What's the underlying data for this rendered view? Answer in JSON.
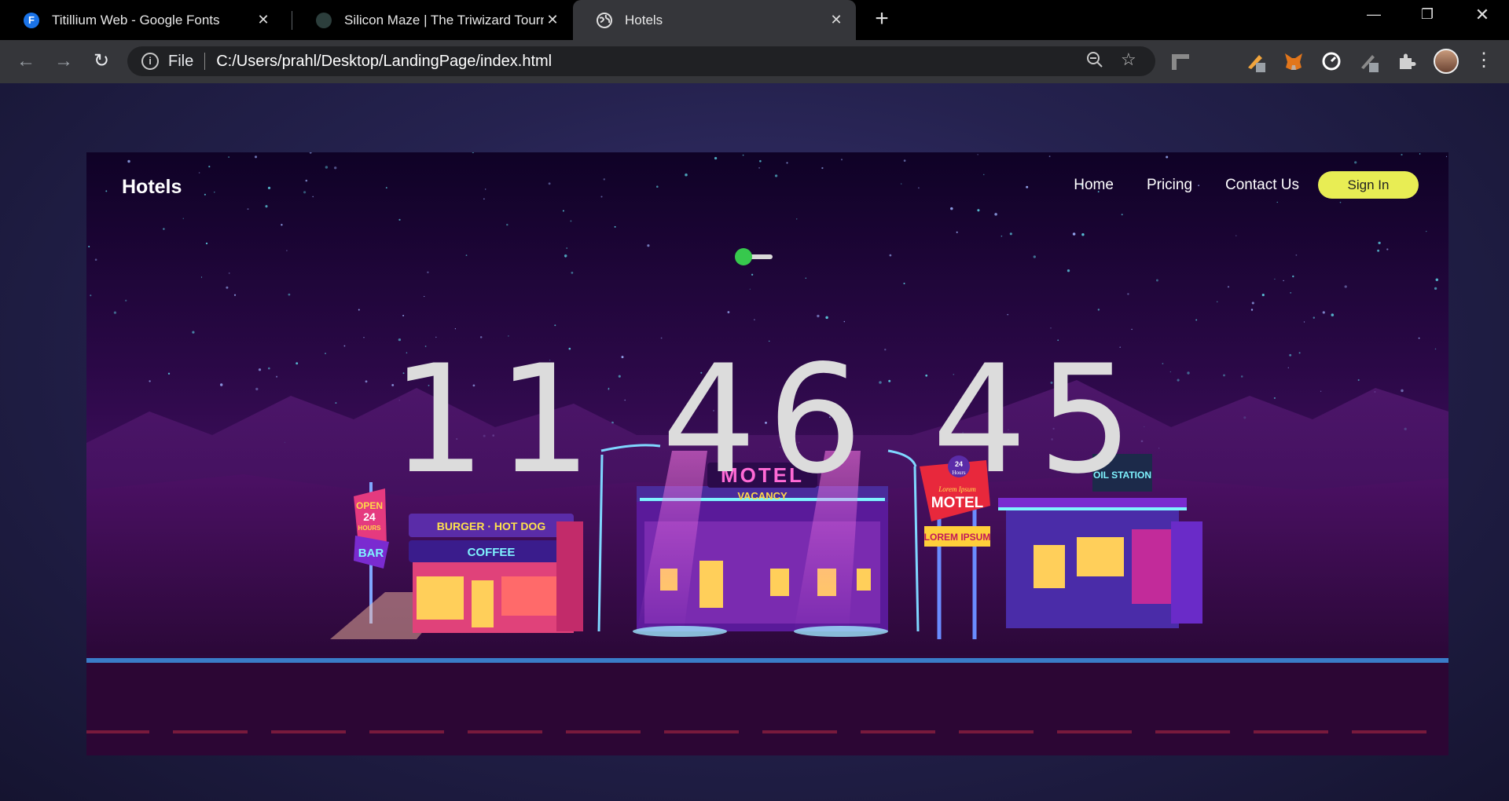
{
  "browser": {
    "tabs": [
      {
        "title": "Titillium Web - Google Fonts",
        "favicon": "F",
        "favicon_color": "#1a73e8",
        "active": false
      },
      {
        "title": "Silicon Maze | The Triwizard Tournament",
        "favicon": "",
        "favicon_color": "#2c3e3c",
        "active": false
      },
      {
        "title": "Hotels",
        "favicon": "globe-icon",
        "active": true
      }
    ],
    "new_tab_icon": "plus-icon",
    "window_controls": [
      "minimize-icon",
      "restore-icon",
      "close-icon"
    ],
    "omnibox": {
      "scheme_label": "File",
      "url": "C:/Users/prahl/Desktop/LandingPage/index.html"
    },
    "extensions": [
      "ruler-icon",
      "pen-icon",
      "metamask-fox-icon",
      "gauge-icon",
      "pencil-icon",
      "puzzle-icon"
    ]
  },
  "page": {
    "brand": "Hotels",
    "nav": [
      {
        "label": "Home"
      },
      {
        "label": "Pricing"
      },
      {
        "label": "Contact Us"
      }
    ],
    "signin_label": "Sign In",
    "theme_toggle": {
      "on": true,
      "color": "#37c84d"
    },
    "clock": "11 46 45",
    "scene_signs": {
      "bar_top": "OPEN",
      "bar_hours_num": "24",
      "bar_hours": "HOURS",
      "bar_name": "BAR",
      "diner_top": "BURGER · HOT DOG",
      "diner_bottom": "COFFEE",
      "motel_main": "MOTEL",
      "motel_sub": "VACANCY",
      "motel_sign_24": "24",
      "motel_sign_hours": "Hours",
      "motel_sign_script": "Lorem Ipsum",
      "motel_sign_main": "MOTEL",
      "motel_sign_panel": "LOREM IPSUM",
      "oil": "OIL STATION"
    },
    "accent_color": "#e8ed54"
  }
}
